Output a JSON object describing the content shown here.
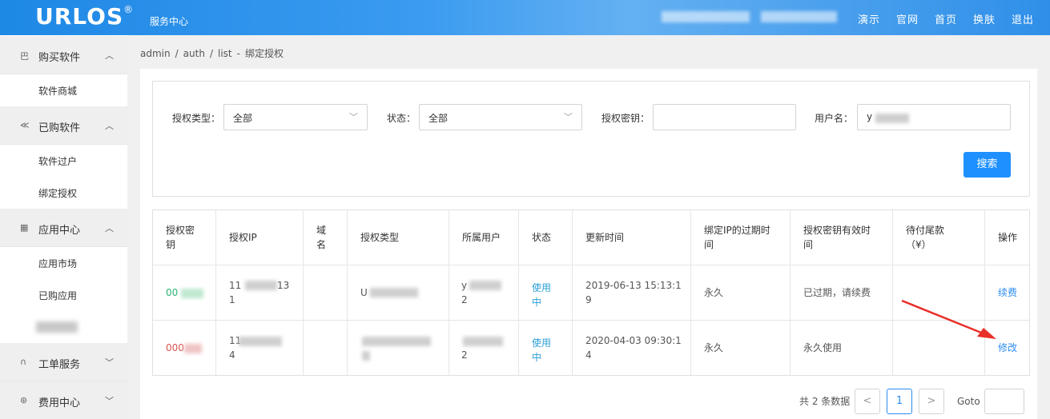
{
  "header": {
    "logo": "URLOS",
    "logo_mark": "®",
    "subtitle": "服务中心",
    "nav": [
      "演示",
      "官网",
      "首页",
      "换肤",
      "退出"
    ]
  },
  "sidebar": {
    "groups": [
      {
        "icon": "shop-icon",
        "label": "购买软件",
        "items": [
          "软件商城"
        ]
      },
      {
        "icon": "share-icon",
        "label": "已购软件",
        "items": [
          "软件过户",
          "绑定授权"
        ]
      },
      {
        "icon": "grid-icon",
        "label": "应用中心",
        "items": [
          "应用市场",
          "已购应用"
        ]
      },
      {
        "icon": "headset-icon",
        "label": "工单服务",
        "items": []
      },
      {
        "icon": "yen-icon",
        "label": "费用中心",
        "items": []
      }
    ]
  },
  "breadcrumb": [
    "admin",
    "/",
    "auth",
    "/",
    "list",
    "-",
    "绑定授权"
  ],
  "filters": {
    "type_label": "授权类型：",
    "type_value": "全部",
    "status_label": "状态：",
    "status_value": "全部",
    "key_label": "授权密钥：",
    "key_value": "",
    "user_label": "用户名：",
    "user_value": "y",
    "search_label": "搜索"
  },
  "table": {
    "headers": [
      "授权密\n钥",
      "授权IP",
      "域\n名",
      "授权类型",
      "所属用户",
      "状态",
      "更新时间",
      "绑定IP的过期时\n间",
      "授权密钥有效时\n间",
      "待付尾款\n（¥）",
      "操作"
    ],
    "rows": [
      {
        "key": "00",
        "ip1": "11",
        "ip2": "13",
        "ip3": "1",
        "domain": "",
        "type": "U",
        "user1": "y",
        "user2": "2",
        "status": "使用\n中",
        "updated1": "2019-06-13 15:13:1",
        "updated2": "9",
        "ip_expire": "永久",
        "key_valid": "已过期，请续费",
        "balance": "",
        "action": "续费"
      },
      {
        "key": "000",
        "ip1": "11",
        "ip2": "",
        "ip3": "4",
        "domain": "",
        "type": "",
        "user1": "",
        "user2": "2",
        "status": "使用\n中",
        "updated1": "2020-04-03 09:30:1",
        "updated2": "4",
        "ip_expire": "永久",
        "key_valid": "永久使用",
        "balance": "",
        "action": "修改"
      }
    ]
  },
  "pagination": {
    "total": "共 2 条数据",
    "prev": "<",
    "current": "1",
    "next": ">",
    "goto_label": "Goto"
  },
  "colors": {
    "header": "#1e88e5",
    "primary": "#1e90ff",
    "arrow": "#e8302a"
  }
}
